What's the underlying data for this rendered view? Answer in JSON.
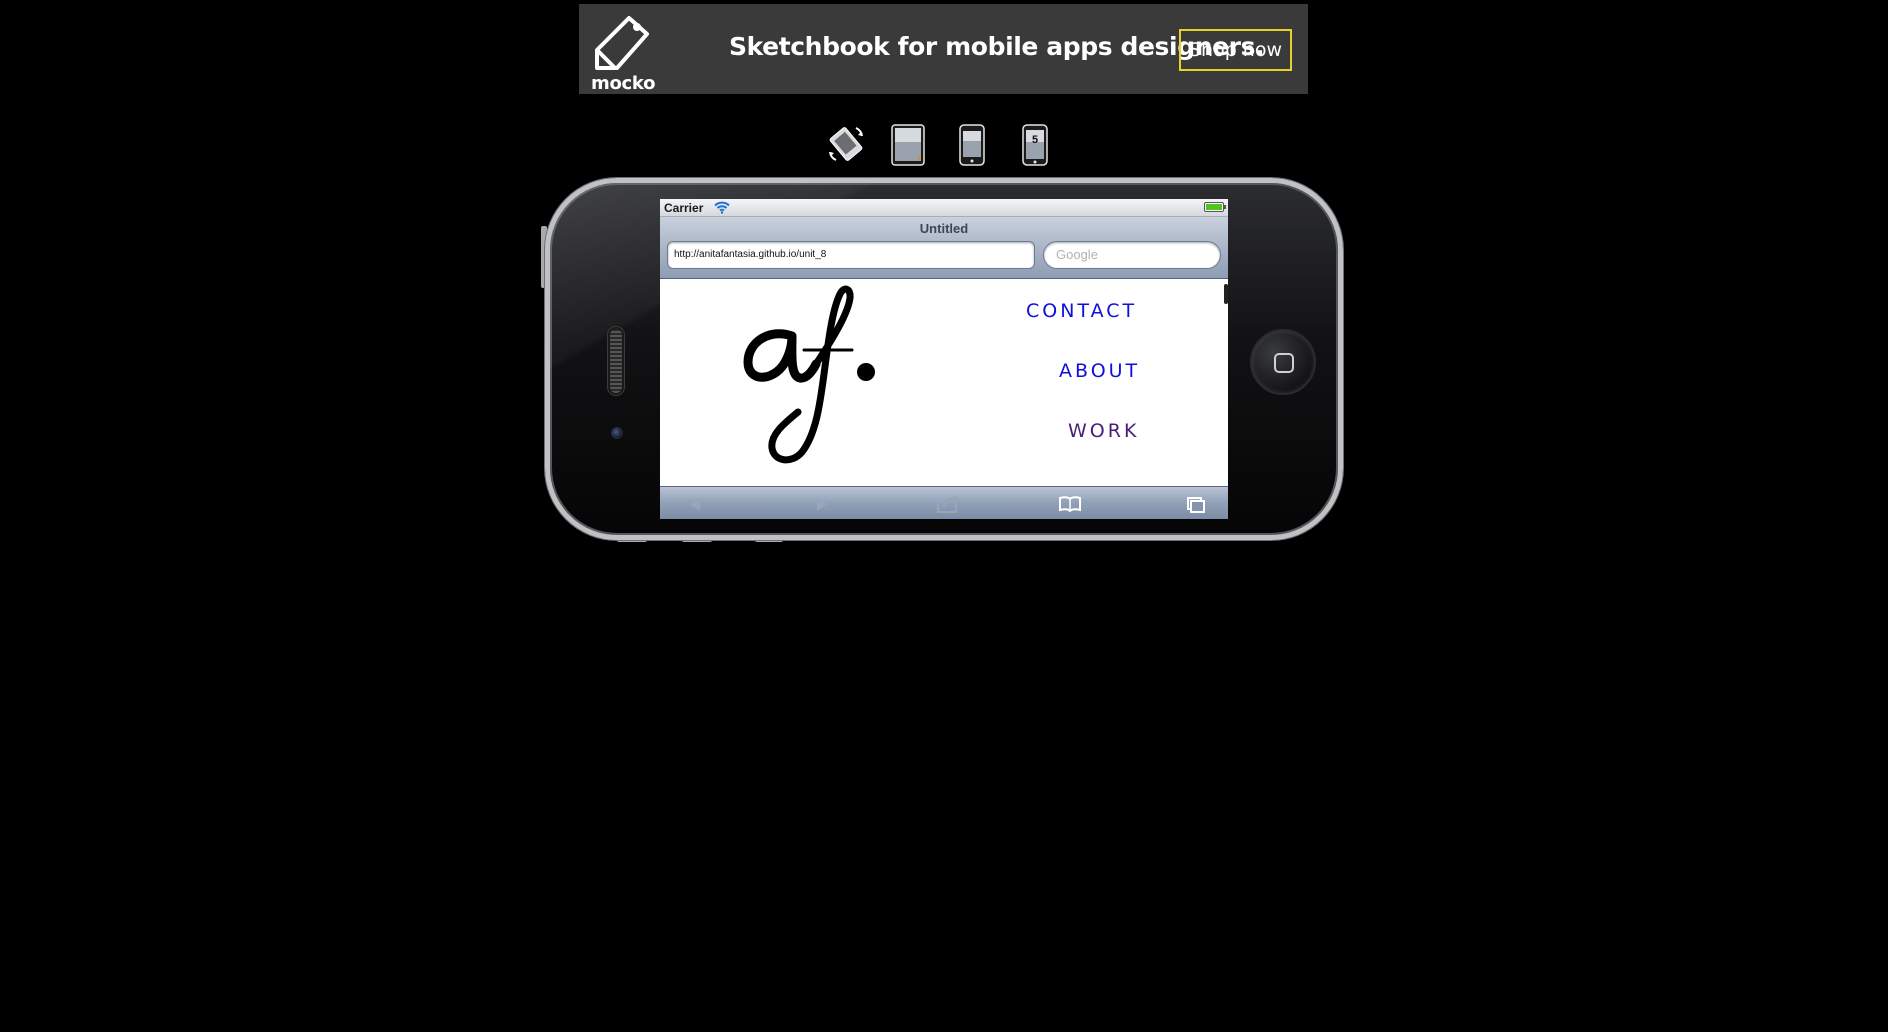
{
  "ad": {
    "brand": "mocko",
    "headline": "Sketchbook for mobile apps designers.",
    "cta": "Shop now",
    "accent_color": "#e8d12a"
  },
  "device_switcher": {
    "items": [
      {
        "name": "rotate-icon"
      },
      {
        "name": "ipad-icon"
      },
      {
        "name": "iphone-icon"
      },
      {
        "name": "iphone5-icon",
        "badge": "5"
      }
    ]
  },
  "statusbar": {
    "carrier": "Carrier",
    "battery_color": "#4fc521"
  },
  "browser": {
    "title": "Untitled",
    "url": "http://anitafantasia.github.io/unit_8",
    "search_placeholder": "Google",
    "toolbar": [
      "back-icon",
      "forward-icon",
      "share-icon",
      "bookmarks-icon",
      "tabs-icon"
    ]
  },
  "site": {
    "logo": "af.",
    "nav": [
      {
        "label": "CONTACT",
        "color": "#1010dd"
      },
      {
        "label": "ABOUT",
        "color": "#1010dd"
      },
      {
        "label": "WORK",
        "color": "#4b1d7a"
      }
    ]
  }
}
